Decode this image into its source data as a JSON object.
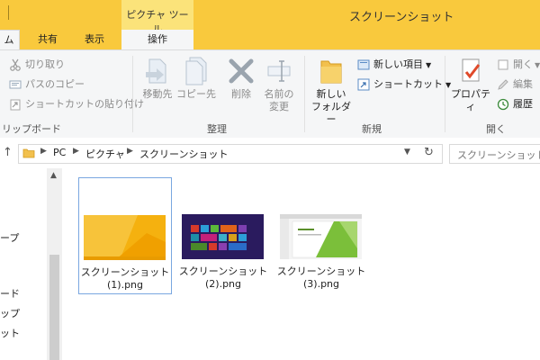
{
  "window": {
    "title": "スクリーンショット",
    "context_tab_group": "ピクチャ ツール"
  },
  "tabs": [
    {
      "label": "ム"
    },
    {
      "label": "共有"
    },
    {
      "label": "表示"
    },
    {
      "label": "操作"
    }
  ],
  "ribbon": {
    "clipboard": {
      "cut": "切り取り",
      "copy_path": "パスのコピー",
      "paste_shortcut": "ショートカットの貼り付け",
      "label": "リップボード"
    },
    "organize": {
      "move_to": "移動先",
      "copy_to": "コピー先",
      "delete": "削除",
      "rename_line1": "名前の",
      "rename_line2": "変更",
      "label": "整理"
    },
    "new": {
      "new_folder_line1": "新しい",
      "new_folder_line2": "フォルダー",
      "new_item": "新しい項目",
      "shortcut": "ショートカット",
      "label": "新規"
    },
    "open": {
      "properties": "プロパティ",
      "open": "開く",
      "edit": "編集",
      "history": "履歴",
      "label": "開く"
    }
  },
  "address": {
    "crumbs": [
      "PC",
      "ピクチャ",
      "スクリーンショット"
    ],
    "search_placeholder": "スクリーンショットの検"
  },
  "navpane": {
    "items": [
      "ープ",
      "ード",
      "ップ",
      "ット"
    ]
  },
  "files": [
    {
      "line1": "スクリーンショット",
      "line2": "(1).png"
    },
    {
      "line1": "スクリーンショット",
      "line2": "(2).png"
    },
    {
      "line1": "スクリーンショット",
      "line2": "(3).png"
    }
  ],
  "colors": {
    "titlebar": "#f9c93d",
    "context_group": "#fbe37a",
    "ribbon": "#f5f6f7",
    "selection_border": "#7aa7e0"
  }
}
